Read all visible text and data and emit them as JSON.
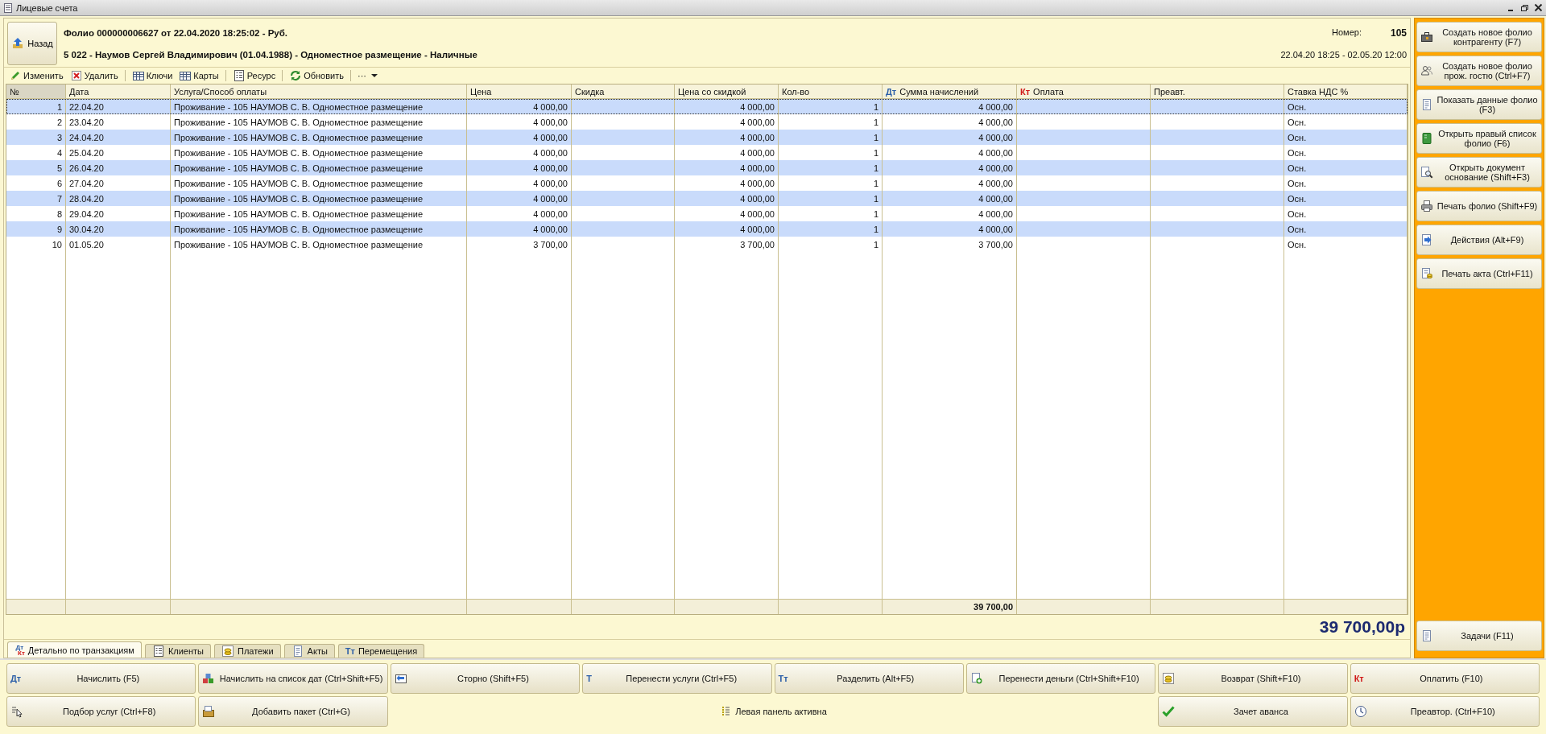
{
  "window": {
    "title": "Лицевые счета"
  },
  "header": {
    "back_button": "Назад",
    "folio_line": "Фолио 000000006627 от 22.04.2020 18:25:02 - Руб.",
    "guest_line": "5 022 - Наумов Сергей Владимирович (01.04.1988) - Одноместное размещение - Наличные",
    "number_label": "Номер:",
    "number": "105",
    "period": "22.04.20 18:25 - 02.05.20 12:00"
  },
  "toolbar": [
    {
      "label": "Изменить"
    },
    {
      "label": "Удалить"
    },
    {
      "label": "Ключи"
    },
    {
      "label": "Карты"
    },
    {
      "label": "Ресурс"
    },
    {
      "label": "Обновить"
    },
    {
      "label": "···"
    }
  ],
  "table": {
    "columns": [
      {
        "label": "№"
      },
      {
        "label": "Дата"
      },
      {
        "label": "Услуга/Способ оплаты"
      },
      {
        "label": "Цена"
      },
      {
        "label": "Скидка"
      },
      {
        "label": "Цена со скидкой"
      },
      {
        "label": "Кол-во"
      },
      {
        "label": "Сумма начислений",
        "prefix": "Дт"
      },
      {
        "label": "Оплата",
        "prefix": "Кт"
      },
      {
        "label": "Преавт."
      },
      {
        "label": "Ставка НДС %"
      }
    ],
    "rows": [
      {
        "selected": true,
        "number": "1",
        "date": "22.04.20",
        "service": "Проживание - 105 НАУМОВ С. В. Одноместное размещение",
        "price": "4 000,00",
        "price_discounted": "4 000,00",
        "quantity": "1",
        "amount": "4 000,00",
        "vat": "Осн."
      },
      {
        "selected": false,
        "number": "2",
        "date": "23.04.20",
        "service": "Проживание - 105 НАУМОВ С. В. Одноместное размещение",
        "price": "4 000,00",
        "price_discounted": "4 000,00",
        "quantity": "1",
        "amount": "4 000,00",
        "vat": "Осн."
      },
      {
        "selected": false,
        "number": "3",
        "date": "24.04.20",
        "service": "Проживание - 105 НАУМОВ С. В. Одноместное размещение",
        "price": "4 000,00",
        "price_discounted": "4 000,00",
        "quantity": "1",
        "amount": "4 000,00",
        "vat": "Осн."
      },
      {
        "selected": false,
        "number": "4",
        "date": "25.04.20",
        "service": "Проживание - 105 НАУМОВ С. В. Одноместное размещение",
        "price": "4 000,00",
        "price_discounted": "4 000,00",
        "quantity": "1",
        "amount": "4 000,00",
        "vat": "Осн."
      },
      {
        "selected": false,
        "number": "5",
        "date": "26.04.20",
        "service": "Проживание - 105 НАУМОВ С. В. Одноместное размещение",
        "price": "4 000,00",
        "price_discounted": "4 000,00",
        "quantity": "1",
        "amount": "4 000,00",
        "vat": "Осн."
      },
      {
        "selected": false,
        "number": "6",
        "date": "27.04.20",
        "service": "Проживание - 105 НАУМОВ С. В. Одноместное размещение",
        "price": "4 000,00",
        "price_discounted": "4 000,00",
        "quantity": "1",
        "amount": "4 000,00",
        "vat": "Осн."
      },
      {
        "selected": false,
        "number": "7",
        "date": "28.04.20",
        "service": "Проживание - 105 НАУМОВ С. В. Одноместное размещение",
        "price": "4 000,00",
        "price_discounted": "4 000,00",
        "quantity": "1",
        "amount": "4 000,00",
        "vat": "Осн."
      },
      {
        "selected": false,
        "number": "8",
        "date": "29.04.20",
        "service": "Проживание - 105 НАУМОВ С. В. Одноместное размещение",
        "price": "4 000,00",
        "price_discounted": "4 000,00",
        "quantity": "1",
        "amount": "4 000,00",
        "vat": "Осн."
      },
      {
        "selected": false,
        "number": "9",
        "date": "30.04.20",
        "service": "Проживание - 105 НАУМОВ С. В. Одноместное размещение",
        "price": "4 000,00",
        "price_discounted": "4 000,00",
        "quantity": "1",
        "amount": "4 000,00",
        "vat": "Осн."
      },
      {
        "selected": false,
        "number": "10",
        "date": "01.05.20",
        "service": "Проживание - 105 НАУМОВ С. В. Одноместное размещение",
        "price": "3 700,00",
        "price_discounted": "3 700,00",
        "quantity": "1",
        "amount": "3 700,00",
        "vat": "Осн."
      }
    ],
    "totals": {
      "amount": "39 700,00"
    }
  },
  "grand_total": "39 700,00р",
  "tabs": [
    {
      "label": "Детально по транзакциям",
      "selected": true,
      "icon_top": "Дт",
      "icon_bottom": "Кт"
    },
    {
      "label": "Клиенты",
      "selected": false
    },
    {
      "label": "Платежи",
      "selected": false
    },
    {
      "label": "Акты",
      "selected": false
    },
    {
      "label": "Перемещения",
      "selected": false,
      "icon_text": "Тт"
    }
  ],
  "side_panel": {
    "buttons": [
      {
        "label": "Создать новое фолио контрагенту (F7)"
      },
      {
        "label": "Создать новое фолио прож. гостю (Ctrl+F7)"
      },
      {
        "label": "Показать данные фолио (F3)"
      },
      {
        "label": "Открыть правый список фолио (F6)"
      },
      {
        "label": "Открыть документ основание (Shift+F3)"
      },
      {
        "label": "Печать фолио (Shift+F9)"
      },
      {
        "label": "Действия (Alt+F9)"
      },
      {
        "label": "Печать акта (Ctrl+F11)"
      }
    ],
    "bottom_button": {
      "label": "Задачи (F11)"
    }
  },
  "actions": [
    {
      "kind": "button",
      "label": "Начислить (F5)",
      "glyph": "Дт"
    },
    {
      "kind": "button",
      "label": "Начислить на список дат (Ctrl+Shift+F5)"
    },
    {
      "kind": "button",
      "label": "Сторно (Shift+F5)"
    },
    {
      "kind": "button",
      "label": "Перенести услуги (Ctrl+F5)",
      "glyph": "Т"
    },
    {
      "kind": "button",
      "label": "Разделить (Alt+F5)",
      "glyph": "Тт"
    },
    {
      "kind": "button",
      "label": "Перенести деньги (Ctrl+Shift+F10)"
    },
    {
      "kind": "button",
      "label": "Возврат (Shift+F10)"
    },
    {
      "kind": "button",
      "label": "Оплатить (F10)",
      "glyph": "Кт"
    },
    {
      "kind": "button",
      "label": "Подбор услуг (Ctrl+F8)"
    },
    {
      "kind": "button",
      "label": "Добавить пакет (Ctrl+G)"
    },
    {
      "kind": "status",
      "label": "Левая панель активна"
    },
    {
      "kind": "button",
      "label": "Зачет аванса"
    },
    {
      "kind": "button",
      "label": "Преавтор. (Ctrl+F10)"
    }
  ]
}
